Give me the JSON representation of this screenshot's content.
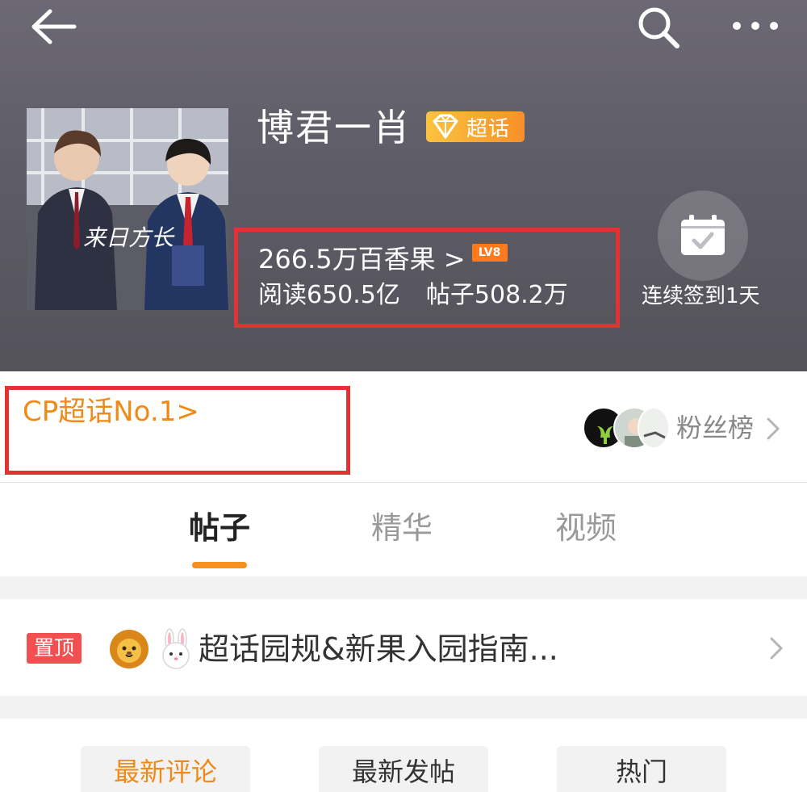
{
  "header": {
    "topic_name": "博君一肖",
    "super_badge_label": "超话",
    "fans_count_text": "266.5万百香果 >",
    "level_badge": "LV8",
    "reads_text": "阅读650.5亿",
    "posts_text": "帖子508.2万",
    "checkin_label": "连续签到1天",
    "cover_caption": "来日方长"
  },
  "rank": {
    "cp_rank_text": "CP超话No.1>",
    "fans_rank_label": "粉丝榜"
  },
  "tabs": [
    {
      "label": "帖子",
      "active": true
    },
    {
      "label": "精华",
      "active": false
    },
    {
      "label": "视频",
      "active": false
    }
  ],
  "pinned": {
    "badge": "置顶",
    "title": "超话园规&新果入园指南...",
    "icons": [
      "lion-emoji-icon",
      "rabbit-emoji-icon"
    ]
  },
  "sort_buttons": [
    {
      "label": "最新评论",
      "active": true
    },
    {
      "label": "最新发帖",
      "active": false
    },
    {
      "label": "热门",
      "active": false
    }
  ],
  "colors": {
    "accent_orange": "#f08a17",
    "highlight_red": "#e03333",
    "pin_red": "#f25050"
  }
}
